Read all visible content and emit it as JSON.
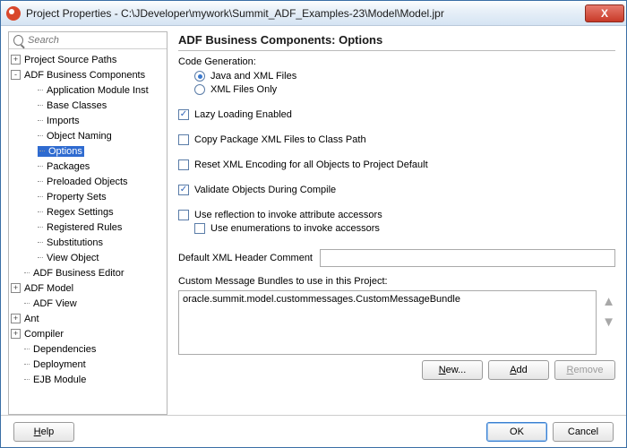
{
  "window": {
    "title": "Project Properties - C:\\JDeveloper\\mywork\\Summit_ADF_Examples-23\\Model\\Model.jpr"
  },
  "search": {
    "placeholder": "Search"
  },
  "tree": [
    {
      "label": "Project Source Paths",
      "depth": 0,
      "expander": "+",
      "sel": false
    },
    {
      "label": "ADF Business Components",
      "depth": 0,
      "expander": "-",
      "sel": false
    },
    {
      "label": "Application Module Inst",
      "depth": 1,
      "leaf": true,
      "sel": false
    },
    {
      "label": "Base Classes",
      "depth": 1,
      "leaf": true,
      "sel": false
    },
    {
      "label": "Imports",
      "depth": 1,
      "leaf": true,
      "sel": false
    },
    {
      "label": "Object Naming",
      "depth": 1,
      "leaf": true,
      "sel": false
    },
    {
      "label": "Options",
      "depth": 1,
      "leaf": true,
      "sel": true
    },
    {
      "label": "Packages",
      "depth": 1,
      "leaf": true,
      "sel": false
    },
    {
      "label": "Preloaded Objects",
      "depth": 1,
      "leaf": true,
      "sel": false
    },
    {
      "label": "Property Sets",
      "depth": 1,
      "leaf": true,
      "sel": false
    },
    {
      "label": "Regex Settings",
      "depth": 1,
      "leaf": true,
      "sel": false
    },
    {
      "label": "Registered Rules",
      "depth": 1,
      "leaf": true,
      "sel": false
    },
    {
      "label": "Substitutions",
      "depth": 1,
      "leaf": true,
      "sel": false
    },
    {
      "label": "View Object",
      "depth": 1,
      "leaf": true,
      "sel": false
    },
    {
      "label": "ADF Business Editor",
      "depth": 0,
      "leaf": true,
      "sel": false
    },
    {
      "label": "ADF Model",
      "depth": 0,
      "expander": "+",
      "sel": false
    },
    {
      "label": "ADF View",
      "depth": 0,
      "leaf": true,
      "sel": false
    },
    {
      "label": "Ant",
      "depth": 0,
      "expander": "+",
      "sel": false
    },
    {
      "label": "Compiler",
      "depth": 0,
      "expander": "+",
      "sel": false
    },
    {
      "label": "Dependencies",
      "depth": 0,
      "leaf": true,
      "sel": false
    },
    {
      "label": "Deployment",
      "depth": 0,
      "leaf": true,
      "sel": false
    },
    {
      "label": "EJB Module",
      "depth": 0,
      "leaf": true,
      "sel": false
    }
  ],
  "panel": {
    "heading": "ADF Business Components: Options",
    "codegen_label": "Code Generation:",
    "radio_java_xml": "Java and XML Files",
    "radio_xml_only": "XML Files Only",
    "chk_lazy": "Lazy Loading Enabled",
    "chk_copy": "Copy Package XML Files to Class Path",
    "chk_reset": "Reset XML Encoding for all Objects to Project Default",
    "chk_validate": "Validate Objects During Compile",
    "chk_reflect": "Use reflection to invoke attribute accessors",
    "chk_enum": "Use enumerations to invoke accessors",
    "default_header_label": "Default XML Header Comment",
    "default_header_value": "",
    "bundles_label": "Custom Message Bundles to use in this Project:",
    "bundle_item": "oracle.summit.model.custommessages.CustomMessageBundle",
    "btn_new": "New...",
    "btn_add": "Add",
    "btn_remove": "Remove",
    "state": {
      "radio_java_xml": true,
      "radio_xml_only": false,
      "chk_lazy": true,
      "chk_copy": false,
      "chk_reset": false,
      "chk_validate": true,
      "chk_reflect": false,
      "chk_enum": false
    }
  },
  "footer": {
    "help": "Help",
    "ok": "OK",
    "cancel": "Cancel"
  }
}
